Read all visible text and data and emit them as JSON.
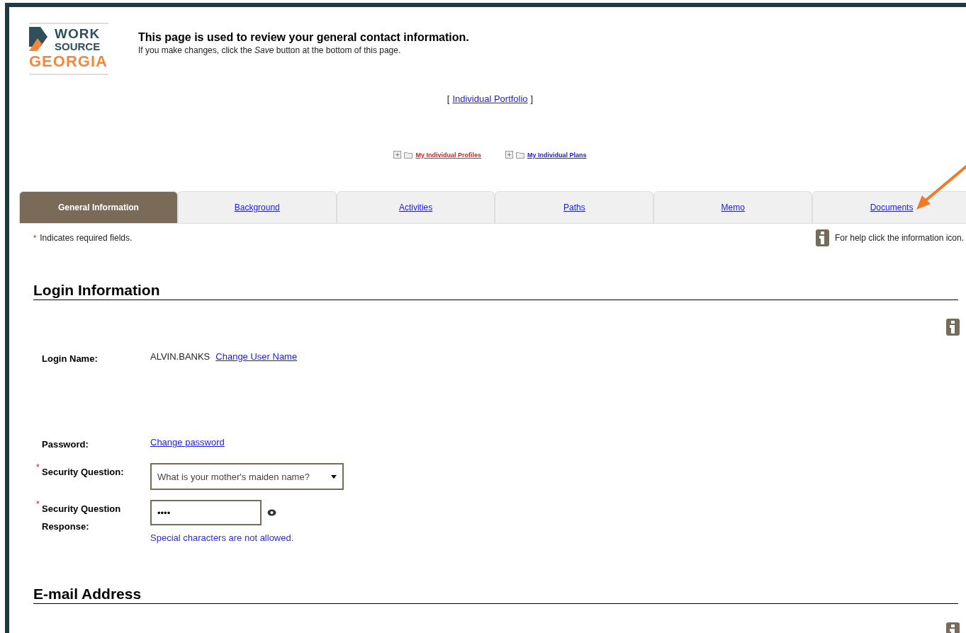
{
  "logo": {
    "line_1": "WORK",
    "line_2": "SOURCE",
    "line_3": "GEORGIA"
  },
  "intro": {
    "title": "This page is used to review your general contact information.",
    "subtitle": "If you make changes, click the *Save* button at the bottom of this page."
  },
  "portfolio": {
    "open": "[",
    "link": "Individual Portfolio",
    "close": "]"
  },
  "tree": [
    {
      "label": "My Individual Profiles",
      "selected": true,
      "expander": "+"
    },
    {
      "label": "My Individual Plans",
      "selected": false,
      "expander": "+"
    }
  ],
  "tabs": [
    {
      "label": "General Information",
      "selected": true
    },
    {
      "label": "Background",
      "selected": false
    },
    {
      "label": "Activities",
      "selected": false
    },
    {
      "label": "Paths",
      "selected": false
    },
    {
      "label": "Memo",
      "selected": false
    },
    {
      "label": "Documents",
      "selected": false
    }
  ],
  "required_note": {
    "mark": "*",
    "text": "Indicates required fields."
  },
  "help_note": "For help click the information icon.",
  "sections": [
    {
      "title": "Login Information",
      "rows": [
        {
          "kind": "text",
          "label": "Login Name:",
          "value": "ALVIN.BANKS",
          "link": "Change User Name"
        },
        {
          "kind": "link",
          "label": "Password:",
          "link": "Change password"
        },
        {
          "kind": "select",
          "mark": "*",
          "label": "Security Question:",
          "value": "What is your mother's maiden name?"
        },
        {
          "kind": "secret",
          "mark": "*",
          "label": "Security Question Response:",
          "value": "••••",
          "hint": "Special characters are not allowed."
        }
      ]
    },
    {
      "title": "E-mail Address"
    }
  ]
}
